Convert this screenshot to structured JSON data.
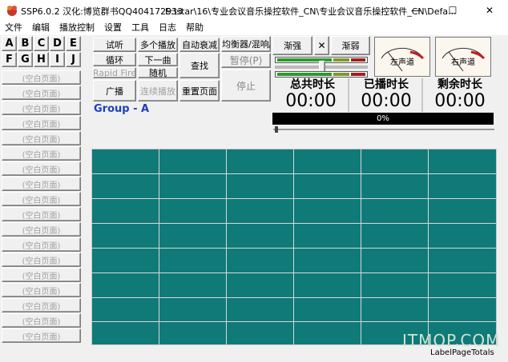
{
  "window": {
    "title": "SSP6.0.2 汉化:博览群书QQ404172933",
    "path": "E:\\star\\16\\专业会议音乐操控软件_CN\\专业会议音乐操控软件_CN\\Defa...",
    "minimize": "—",
    "maximize": "☐",
    "close": "✕"
  },
  "menu": [
    "文件",
    "编辑",
    "播放控制",
    "设置",
    "工具",
    "日志",
    "帮助"
  ],
  "letters": [
    "A",
    "B",
    "C",
    "D",
    "E",
    "F",
    "G",
    "H",
    "I",
    "J"
  ],
  "pages": [
    "(空白页面)",
    "(空白页面)",
    "(空白页面)",
    "(空白页面)",
    "(空白页面)",
    "(空白页面)",
    "(空白页面)",
    "(空白页面)",
    "(空白页面)",
    "(空白页面)",
    "(空白页面)",
    "(空白页面)",
    "(空白页面)",
    "(空白页面)",
    "(空白页面)",
    "(空白页面)",
    "(空白页面)",
    "(空白页面)"
  ],
  "controls": {
    "preview": "试听",
    "multi_play": "多个播放",
    "auto_fade": "自动衰减",
    "eq_mixer": "均衡器/混响/节拍",
    "loop": "循环",
    "next": "下一曲",
    "find": "查找",
    "pause": "暂停(P)",
    "rapid_fire": "Rapid Fire",
    "random": "随机",
    "broadcast": "广播",
    "continuous": "连续播放",
    "reset_page": "重置页面",
    "stop": "停止",
    "fade_in": "渐强",
    "x": "✕",
    "fade_out": "渐弱"
  },
  "vu": {
    "left": "左声道",
    "right": "右声道"
  },
  "times": {
    "total_label": "总共时长",
    "total": "00:00",
    "played_label": "已播时长",
    "played": "00:00",
    "remain_label": "剩余时长",
    "remain": "00:00"
  },
  "progress": {
    "label": "0%",
    "value": 0
  },
  "group": "Group - A",
  "footer": {
    "label": "LabelPageTotals",
    "watermark": "ITMOP.COM"
  },
  "colors": {
    "grid": "#0f7a78",
    "group_text": "#1c3fbf",
    "meter_green": "#2c9a2c",
    "meter_red": "#a02020"
  }
}
